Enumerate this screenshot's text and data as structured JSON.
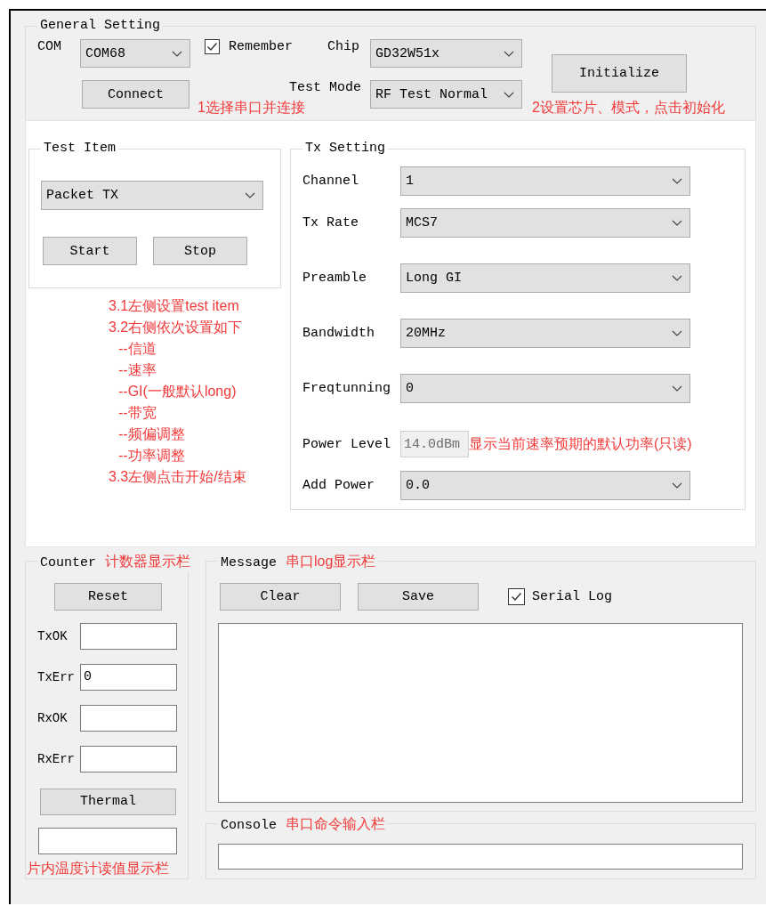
{
  "general_setting": {
    "title": "General Setting",
    "com": {
      "label": "COM",
      "value": "COM68"
    },
    "remember": {
      "label": "Remember",
      "checked": true
    },
    "chip": {
      "label": "Chip",
      "value": "GD32W51x"
    },
    "connect_button": "Connect",
    "test_mode": {
      "label": "Test Mode",
      "value": "RF Test Normal"
    },
    "initialize_button": "Initialize",
    "notes": [
      "1选择串口并连接",
      "2设置芯片、模式，点击初始化"
    ]
  },
  "test_item": {
    "title": "Test Item",
    "value": "Packet TX",
    "buttons": [
      "Start",
      "Stop"
    ]
  },
  "instructions": [
    {
      "text": "3.1左侧设置test item",
      "kind": "step"
    },
    {
      "text": "3.2右侧依次设置如下",
      "kind": "step"
    },
    {
      "text": "--信道",
      "kind": "sub"
    },
    {
      "text": "--速率",
      "kind": "sub"
    },
    {
      "text": "--GI(一般默认long)",
      "kind": "sub"
    },
    {
      "text": "--带宽",
      "kind": "sub"
    },
    {
      "text": "--频偏调整",
      "kind": "sub"
    },
    {
      "text": "--功率调整",
      "kind": "sub"
    },
    {
      "text": "3.3左侧点击开始/结束",
      "kind": "step"
    }
  ],
  "tx_setting": {
    "title": "Tx Setting",
    "fields": [
      {
        "label": "Channel",
        "value": "1",
        "kind": "dropdown"
      },
      {
        "label": "Tx Rate",
        "value": "MCS7",
        "kind": "dropdown"
      },
      {
        "label": "Preamble",
        "value": "Long GI",
        "kind": "dropdown"
      },
      {
        "label": "Bandwidth",
        "value": "20MHz",
        "kind": "dropdown"
      },
      {
        "label": "Freqtunning",
        "value": "0",
        "kind": "dropdown"
      },
      {
        "label": "Power Level",
        "value": "14.0dBm",
        "kind": "readonly",
        "note": "显示当前速率预期的默认功率(只读)"
      },
      {
        "label": "Add Power",
        "value": "0.0",
        "kind": "dropdown"
      }
    ]
  },
  "counter": {
    "title": "Counter",
    "note": "计数器显示栏",
    "reset_button": "Reset",
    "fields": [
      {
        "label": "TxOK"
      },
      {
        "label": "TxErr",
        "value": "0"
      },
      {
        "label": "RxOK"
      },
      {
        "label": "RxErr"
      }
    ],
    "thermal_button": "Thermal",
    "thermal_note": "片内温度计读值显示栏"
  },
  "message": {
    "title": "Message",
    "note": "串口log显示栏",
    "buttons": [
      "Clear",
      "Save"
    ],
    "serial_log": {
      "label": "Serial Log",
      "checked": true
    }
  },
  "console": {
    "title": "Console",
    "note": "串口命令输入栏"
  }
}
